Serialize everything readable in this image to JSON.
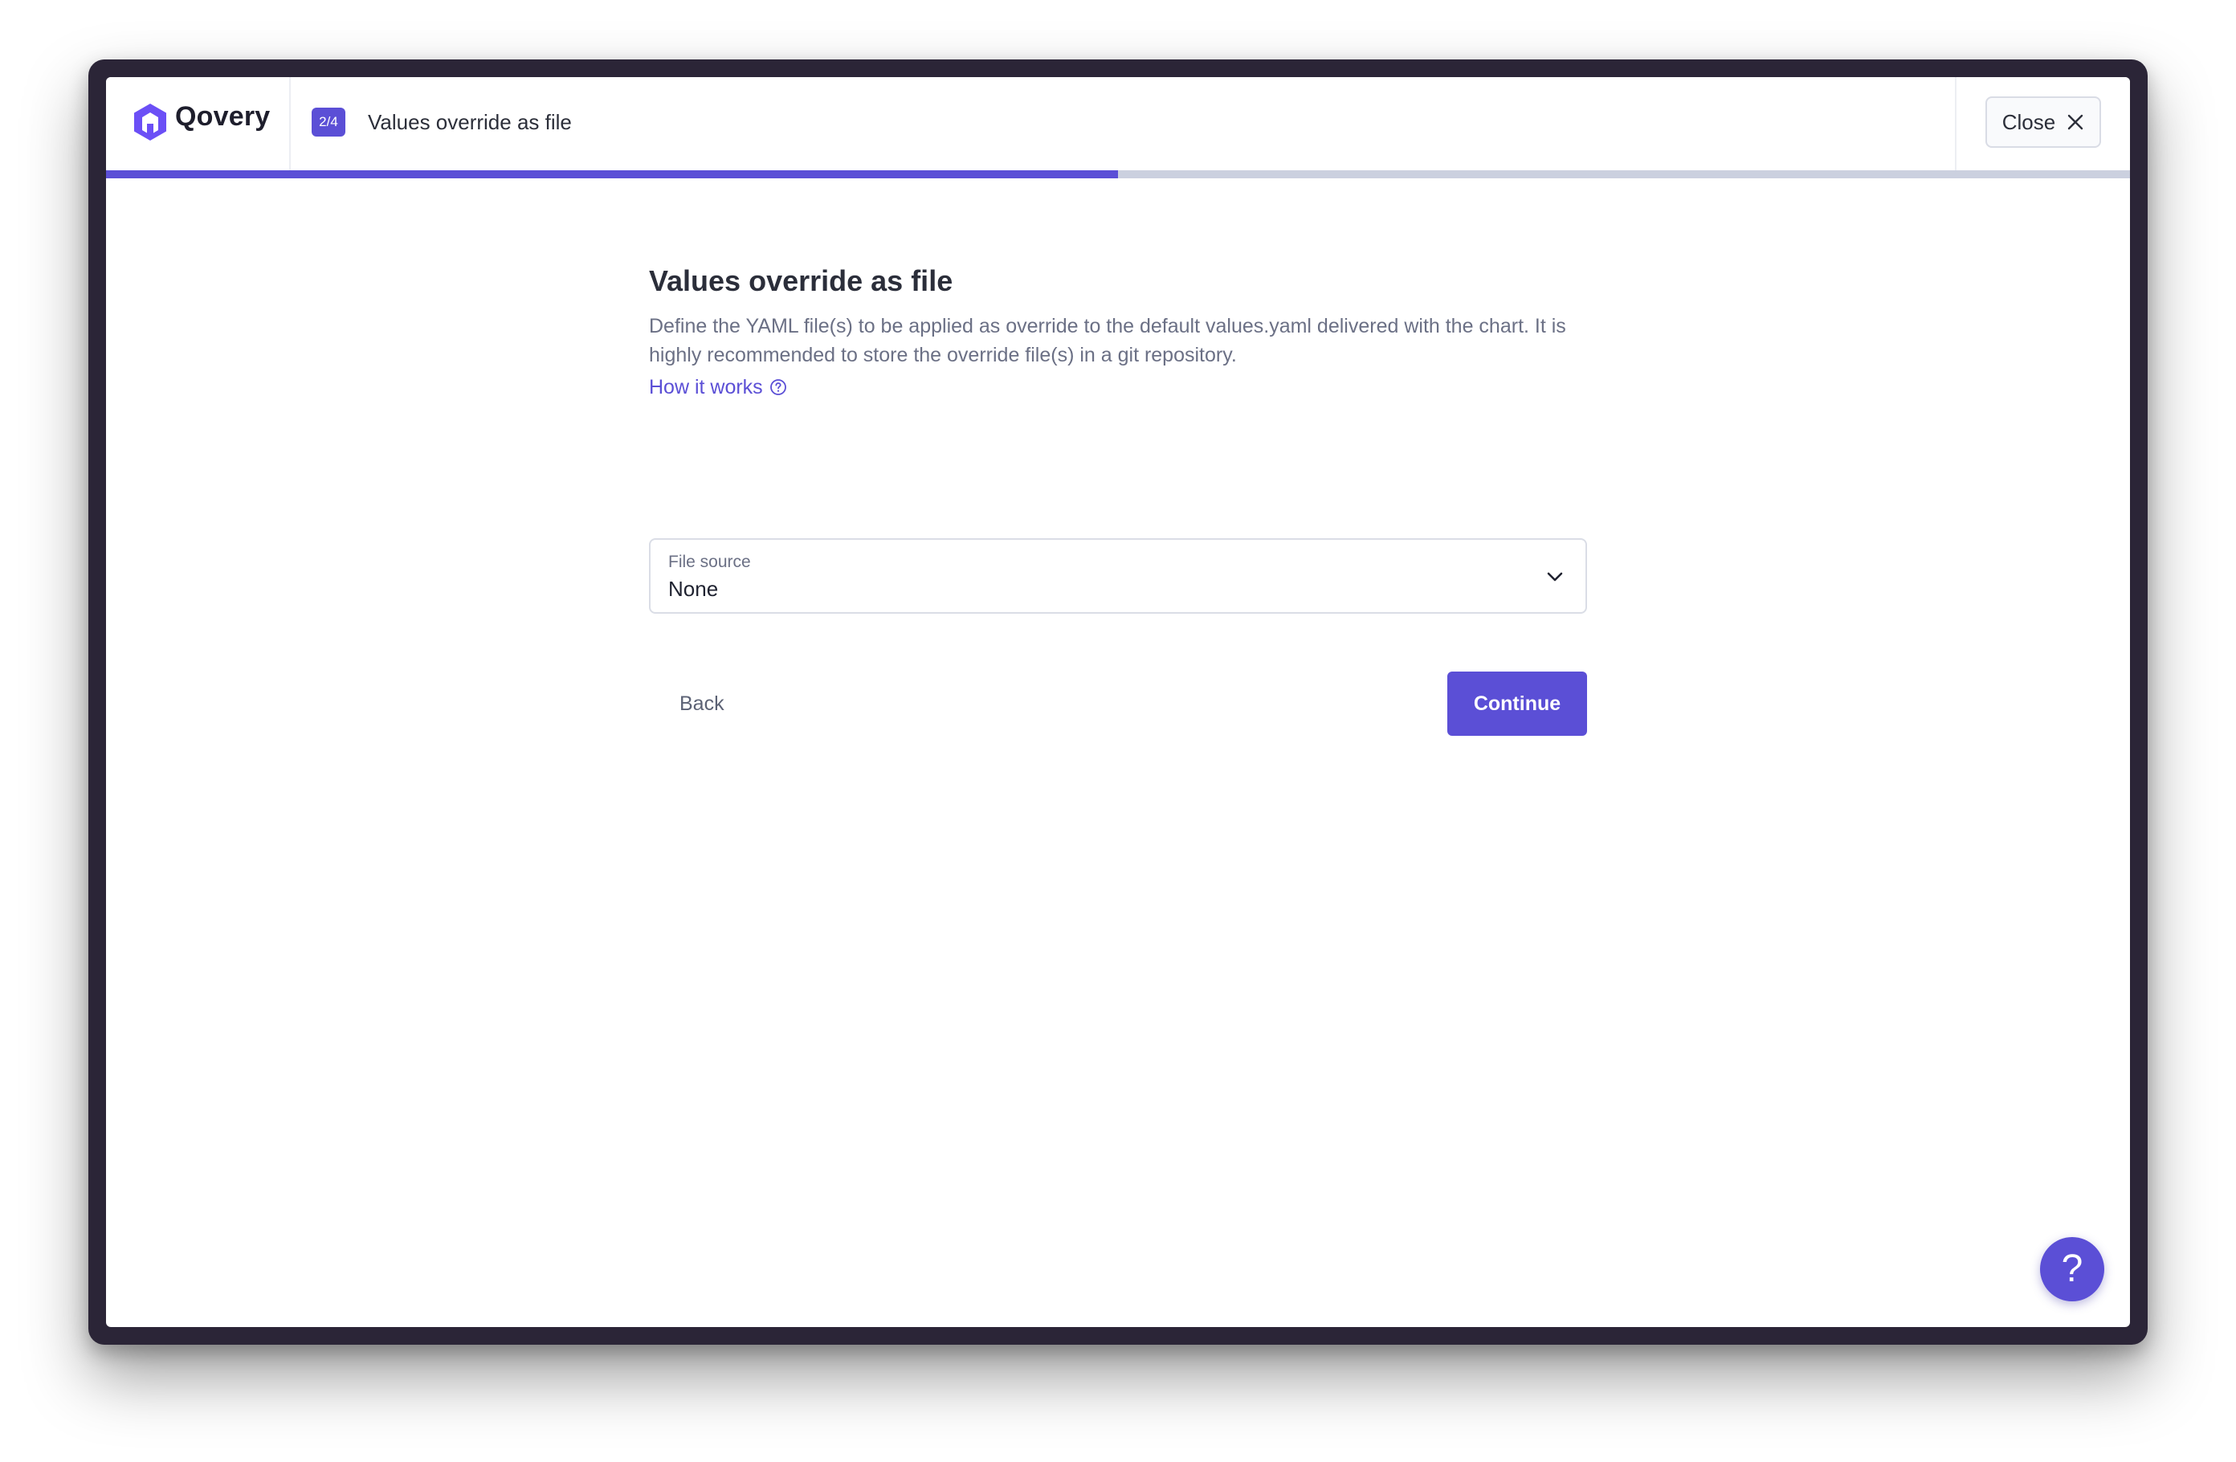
{
  "app": {
    "name": "Qovery"
  },
  "header": {
    "step": "2/4",
    "title": "Values override as file",
    "close_label": "Close",
    "progress": 0.5
  },
  "main": {
    "title": "Values override as file",
    "description": "Define the YAML file(s) to be applied as override to the default values.yaml delivered with the chart. It is highly recommended to store the override file(s) in a git repository.",
    "link_label": "How it works",
    "file_source": {
      "label": "File source",
      "value": "None"
    },
    "back_label": "Back",
    "continue_label": "Continue"
  },
  "help": {
    "label": "?"
  },
  "colors": {
    "accent": "#5b4fd6",
    "progress_track": "#cbd0df"
  }
}
